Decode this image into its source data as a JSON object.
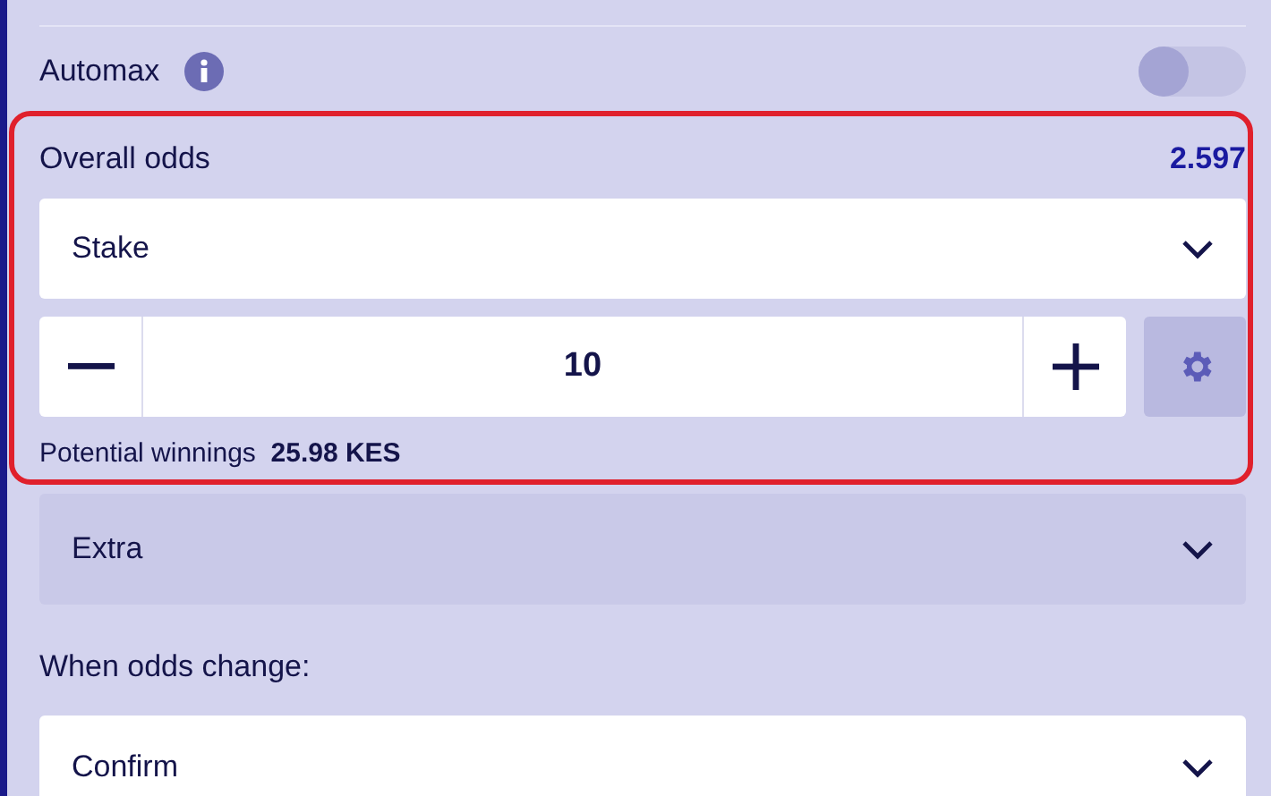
{
  "automax": {
    "label": "Automax",
    "on": false
  },
  "odds_section": {
    "highlighted": true,
    "label": "Overall odds",
    "value": "2.597",
    "stake_select": {
      "value": "Stake"
    },
    "stake": {
      "value": "10"
    },
    "winnings_label": "Potential winnings",
    "winnings_value": "25.98 KES"
  },
  "extra_select": {
    "value": "Extra"
  },
  "odds_change": {
    "label": "When odds change:",
    "select": {
      "value": "Confirm"
    }
  }
}
